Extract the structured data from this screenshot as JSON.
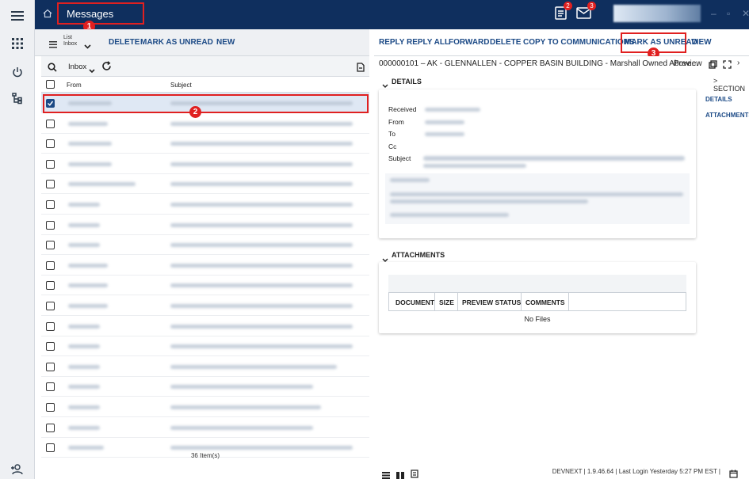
{
  "topbar": {
    "title": "Messages",
    "tasks_badge": "2",
    "mail_badge": "3",
    "window_controls": [
      "–",
      "▫",
      "✕"
    ]
  },
  "markers": [
    "1",
    "2",
    "3"
  ],
  "list_toolbar": {
    "view_line1": "List",
    "view_line2": "Inbox",
    "delete": "DELETE",
    "mark_unread": "MARK AS UNREAD",
    "new": "NEW"
  },
  "message_toolbar": {
    "reply": "REPLY",
    "reply_all": "REPLY ALL",
    "forward": "FORWARD",
    "delete": "DELETE",
    "copy": "COPY TO COMMUNICATIONS",
    "mark_unread": "MARK AS UNREAD",
    "view": "VIEW"
  },
  "list": {
    "folder": "Inbox",
    "col_from": "From",
    "col_subject": "Subject",
    "item_count": "36 Item(s)",
    "row_count": 18,
    "selected_row": 0
  },
  "preview": {
    "subject": "000000101 – AK - GLENNALLEN - COPPER BASIN BUILDING - Marshall Owned Above...",
    "preview_label": "Preview",
    "details_header": "DETAILS",
    "sections_label": "> SECTION",
    "nav_details": "DETAILS",
    "nav_attachments": "ATTACHMENTS",
    "fields": {
      "received": "Received",
      "from": "From",
      "to": "To",
      "cc": "Cc",
      "subject": "Subject"
    },
    "attachments_header": "ATTACHMENTS",
    "att_cols": [
      "DOCUMENT",
      "SIZE",
      "PREVIEW STATUS",
      "COMMENTS"
    ],
    "no_files": "No Files"
  },
  "footer": {
    "status": "DEVNEXT  |  1.9.46.64  |  Last Login Yesterday 5:27 PM EST  |"
  },
  "colors": {
    "topbar": "#0f2f5e",
    "accent": "#1c4a86",
    "highlight": "#e02020"
  }
}
